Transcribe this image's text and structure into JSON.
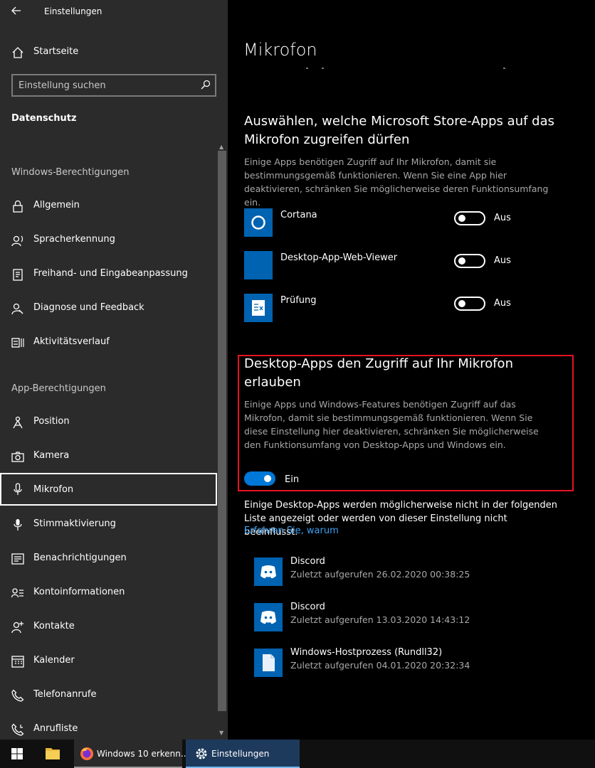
{
  "window": {
    "title": "Einstellungen"
  },
  "sidebar": {
    "home_label": "Startseite",
    "search": {
      "placeholder": "Einstellung suchen"
    },
    "section_title": "Datenschutz",
    "windows_permissions_header": "Windows-Berechtigungen",
    "windows_items": [
      {
        "label": "Allgemein",
        "icon": "lock-icon"
      },
      {
        "label": "Spracherkennung",
        "icon": "speech-icon"
      },
      {
        "label": "Freihand- und Eingabeanpassung",
        "icon": "notepad-icon"
      },
      {
        "label": "Diagnose und Feedback",
        "icon": "feedback-icon"
      },
      {
        "label": "Aktivitätsverlauf",
        "icon": "timeline-icon"
      }
    ],
    "app_permissions_header": "App-Berechtigungen",
    "app_items": [
      {
        "label": "Position",
        "icon": "location-icon"
      },
      {
        "label": "Kamera",
        "icon": "camera-icon"
      },
      {
        "label": "Mikrofon",
        "icon": "microphone-icon",
        "selected": true
      },
      {
        "label": "Stimmaktivierung",
        "icon": "voice-activation-icon"
      },
      {
        "label": "Benachrichtigungen",
        "icon": "notifications-icon"
      },
      {
        "label": "Kontoinformationen",
        "icon": "account-info-icon"
      },
      {
        "label": "Kontakte",
        "icon": "contacts-icon"
      },
      {
        "label": "Kalender",
        "icon": "calendar-icon"
      },
      {
        "label": "Telefonanrufe",
        "icon": "phone-icon"
      },
      {
        "label": "Anrufliste",
        "icon": "call-history-icon"
      }
    ]
  },
  "main": {
    "page_title": "Mikrofon",
    "store_section": {
      "heading": "Auswählen, welche Microsoft Store-Apps auf das Mikrofon zugreifen dürfen",
      "description": "Einige Apps benötigen Zugriff auf Ihr Mikrofon, damit sie bestimmungsgemäß funktionieren. Wenn Sie eine App hier deaktivieren, schränken Sie möglicherweise deren Funktionsumfang ein.",
      "apps": [
        {
          "name": "Cortana",
          "state": "Aus",
          "icon": "cortana-icon"
        },
        {
          "name": "Desktop-App-Web-Viewer",
          "state": "Aus",
          "icon": "app-tile-icon"
        },
        {
          "name": "Prüfung",
          "state": "Aus",
          "icon": "checklist-icon"
        }
      ]
    },
    "desktop_section": {
      "heading": "Desktop-Apps den Zugriff auf Ihr Mikrofon erlauben",
      "description": "Einige Apps und Windows-Features benötigen Zugriff auf das Mikrofon, damit sie bestimmungsgemäß funktionieren. Wenn Sie diese Einstellung hier deaktivieren, schränken Sie möglicherweise den Funktionsumfang von Desktop-Apps und Windows ein.",
      "toggle_state": "Ein",
      "note": "Einige Desktop-Apps werden möglicherweise nicht in der folgenden Liste angezeigt oder werden von dieser Einstellung nicht beeinflusst.",
      "link": "Erfahren Sie, warum",
      "apps": [
        {
          "name": "Discord",
          "last_used": "Zuletzt aufgerufen 26.02.2020 00:38:25",
          "icon": "discord-icon"
        },
        {
          "name": "Discord",
          "last_used": "Zuletzt aufgerufen 13.03.2020 14:43:12",
          "icon": "discord-icon"
        },
        {
          "name": "Windows-Hostprozess (Rundll32)",
          "last_used": "Zuletzt aufgerufen 04.01.2020 20:32:34",
          "icon": "file-icon"
        }
      ]
    }
  },
  "taskbar": {
    "firefox_label": "Windows 10 erkenn...",
    "settings_label": "Einstellungen"
  },
  "colors": {
    "accent": "#0078d7",
    "tile": "#0063b1",
    "highlight_border": "#e81123",
    "link": "#3b9ff0"
  }
}
